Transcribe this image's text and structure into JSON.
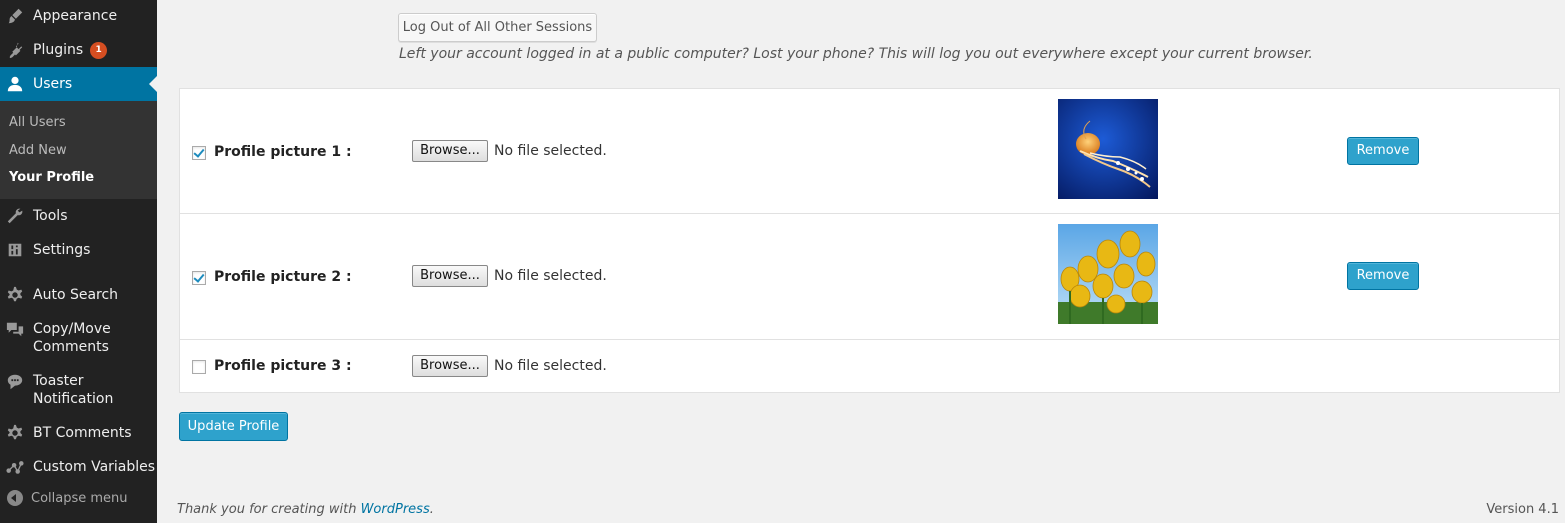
{
  "sidebar": {
    "items": [
      {
        "label": "Appearance",
        "icon": "paintbrush-icon"
      },
      {
        "label": "Plugins",
        "icon": "plugin-icon",
        "badge": "1"
      },
      {
        "label": "Users",
        "icon": "user-icon",
        "current": true
      },
      {
        "label": "Tools",
        "icon": "wrench-icon"
      },
      {
        "label": "Settings",
        "icon": "settings-sliders-icon"
      },
      {
        "label": "Auto Search",
        "icon": "gear-icon"
      },
      {
        "label": "Copy/Move Comments",
        "line1": "Copy/Move",
        "line2": "Comments",
        "icon": "comments-icon"
      },
      {
        "label": "Toaster Notification",
        "line1": "Toaster",
        "line2": "Notification",
        "icon": "speech-bubble-icon"
      },
      {
        "label": "BT Comments",
        "icon": "gear-icon"
      },
      {
        "label": "Custom Variables",
        "icon": "network-icon"
      }
    ],
    "submenu": [
      "All Users",
      "Add New",
      "Your Profile"
    ],
    "submenu_active": "Your Profile",
    "collapse_label": "Collapse menu"
  },
  "sessions": {
    "button_label": "Log Out of All Other Sessions",
    "description": "Left your account logged in at a public computer? Lost your phone? This will log you out everywhere except your current browser."
  },
  "profile_pictures": [
    {
      "label": "Profile picture 1 :",
      "checked": true,
      "browse_label": "Browse...",
      "file_status": "No file selected.",
      "image": "jellyfish-image",
      "remove_label": "Remove"
    },
    {
      "label": "Profile picture 2 :",
      "checked": true,
      "browse_label": "Browse...",
      "file_status": "No file selected.",
      "image": "tulips-image",
      "remove_label": "Remove"
    },
    {
      "label": "Profile picture 3 :",
      "checked": false,
      "browse_label": "Browse...",
      "file_status": "No file selected."
    }
  ],
  "update_button": "Update Profile",
  "footer": {
    "thanks_prefix": "Thank you for creating with ",
    "thanks_link": "WordPress",
    "thanks_suffix": ".",
    "version": "Version 4.1"
  },
  "colors": {
    "sidebar_bg": "#222222",
    "submenu_bg": "#333333",
    "accent": "#0074a2",
    "primary_button": "#2ea2cc",
    "badge": "#d54e21",
    "page_bg": "#f1f1f1"
  }
}
